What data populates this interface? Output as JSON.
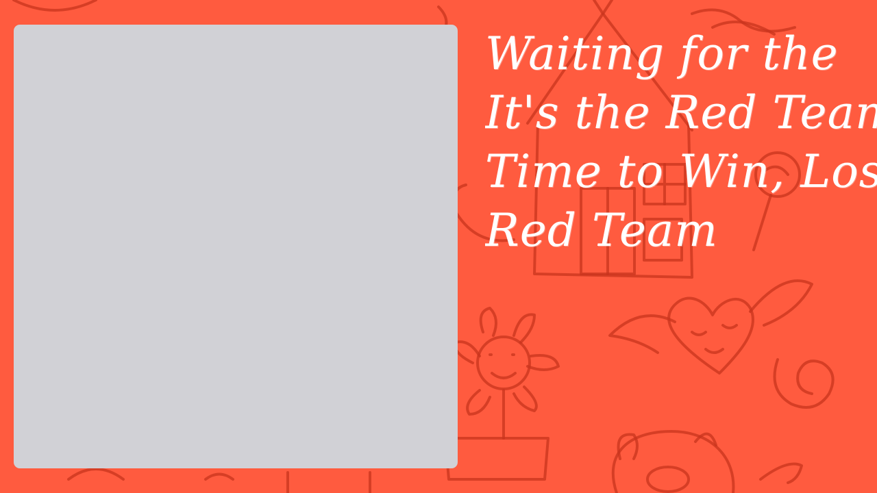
{
  "theme": {
    "background": "#ff5b3f",
    "doodle_color": "#c8341e",
    "panel_color": "#d1d1d6",
    "text_color": "#ffffff"
  },
  "media": {
    "icon": "blank-media-placeholder"
  },
  "message": {
    "lines": [
      "Waiting for the",
      "It's the Red Team",
      "Time to Win, Los",
      "Red Team"
    ]
  }
}
